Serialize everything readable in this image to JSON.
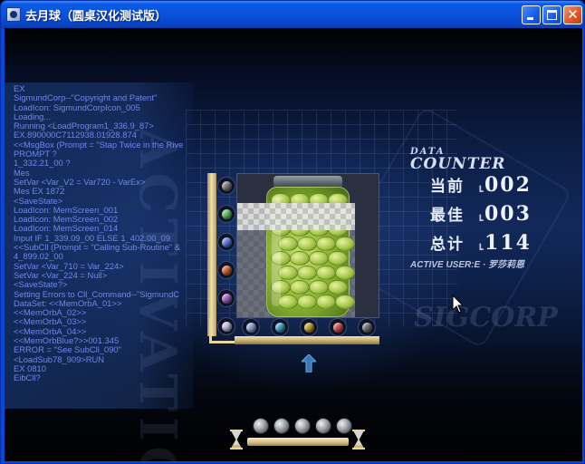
{
  "window": {
    "title": "去月球（圆桌汉化测试版）",
    "icon": "app-icon",
    "controls": {
      "minimize": "minimize-icon",
      "maximize": "maximize-icon",
      "close": "✕"
    }
  },
  "console": {
    "lines": [
      "EX",
      " SigmundCorp--\"Copyright and Patent\"",
      "LoadIcon: SigmundCorpIcon_005",
      "Loading...",
      "Running <LoadProgram1_336.9_87>",
      "EX.890000C7112938.01928.874",
      "<<MsgBox (Prompt = \"Stap Twice in the Rive",
      "PROMPT ?",
      "   1_332.21_00 ?",
      " Mes",
      "SetVar <Var_V2 = Var720 - VarEx>",
      "  Mes    EX 1872",
      "<SaveState>",
      "LoadIcon: MemScreen_001",
      "LoadIcon: MemScreen_002",
      "LoadIcon: MemScreen_014",
      "Input IF 1_339.09_00 ELSE 1_402.00_09",
      "<<SubCll (Prompt = \"Calling Sub-Routine\" &",
      "   4_899.02_00",
      "SetVar <Var_710 = Var_224>",
      "SetVar <Var_224 = Null>",
      "<SaveState?>",
      " Setting Errors to Cll_Command--\"SigmundC",
      "DataSet: <<MemOrbA_01>>",
      "   <<MemOrbA_02>>",
      "   <<MemOrbA_03>>",
      "   <<MemOrbA_04>>",
      "   <<MemOrbBlue?>>001.345",
      "ERROR = \"See SubCll_090\"",
      "<LoadSub78_909>RUN",
      "EX 0810",
      "   EibCll?"
    ]
  },
  "counter": {
    "data_label": "DATA",
    "counter_label": "COUNTER",
    "rows": [
      {
        "label": "当前",
        "value": "002"
      },
      {
        "label": "最佳",
        "value": "003"
      },
      {
        "label": "总计",
        "value": "114"
      }
    ],
    "active_user": "ACTIVE USER:E · 罗莎莉恩"
  },
  "watermarks": {
    "corp": "SIGCORP"
  },
  "memento_slots": {
    "vertical": [
      "#7a7a7a",
      "#5cc05c",
      "#5c7ae0",
      "#d06030",
      "#a060c0",
      "#c0c0e0"
    ],
    "horizontal": [
      "#8aa0d0",
      "#40a0c0",
      "#c0a030",
      "#d05050",
      "#707070"
    ]
  },
  "colors": {
    "console_text": "#6f86ec",
    "frame_gold": "#e6d6a0"
  }
}
